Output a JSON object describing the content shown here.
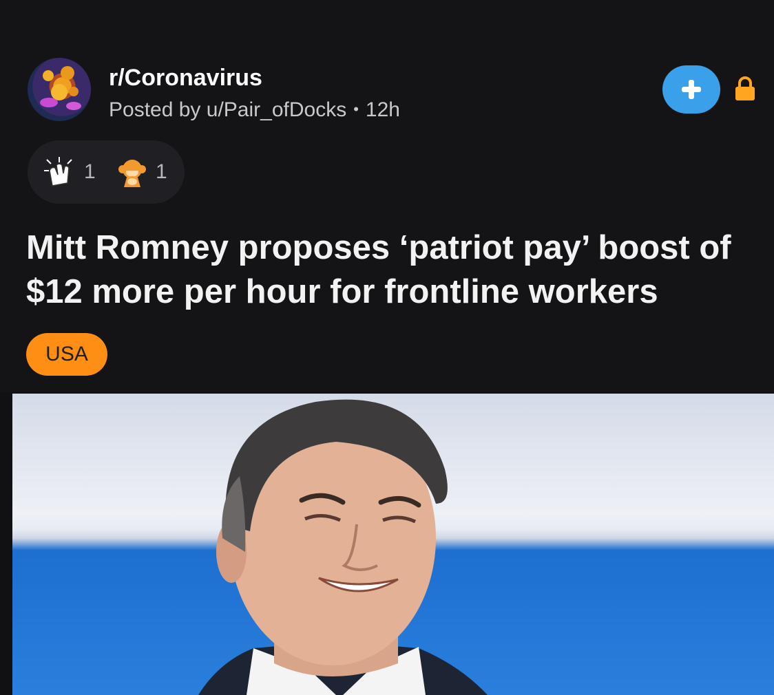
{
  "post": {
    "subreddit": "r/Coronavirus",
    "posted_by_prefix": "Posted by",
    "author": "u/Pair_ofDocks",
    "age": "12h",
    "title": "Mitt Romney proposes ‘patriot pay’ boost of $12 more per hour for frontline workers",
    "flair": "USA"
  },
  "awards": [
    {
      "icon": "clapping-hands-award-icon",
      "count": "1"
    },
    {
      "icon": "monkey-award-icon",
      "count": "1"
    }
  ],
  "icons": {
    "avatar": "coronavirus-avatar",
    "join": "plus-icon",
    "lock": "lock-icon"
  },
  "colors": {
    "background": "#141417",
    "join_button": "#3aa0ea",
    "lock": "#ffa51f",
    "flair": "#ff8f14"
  }
}
